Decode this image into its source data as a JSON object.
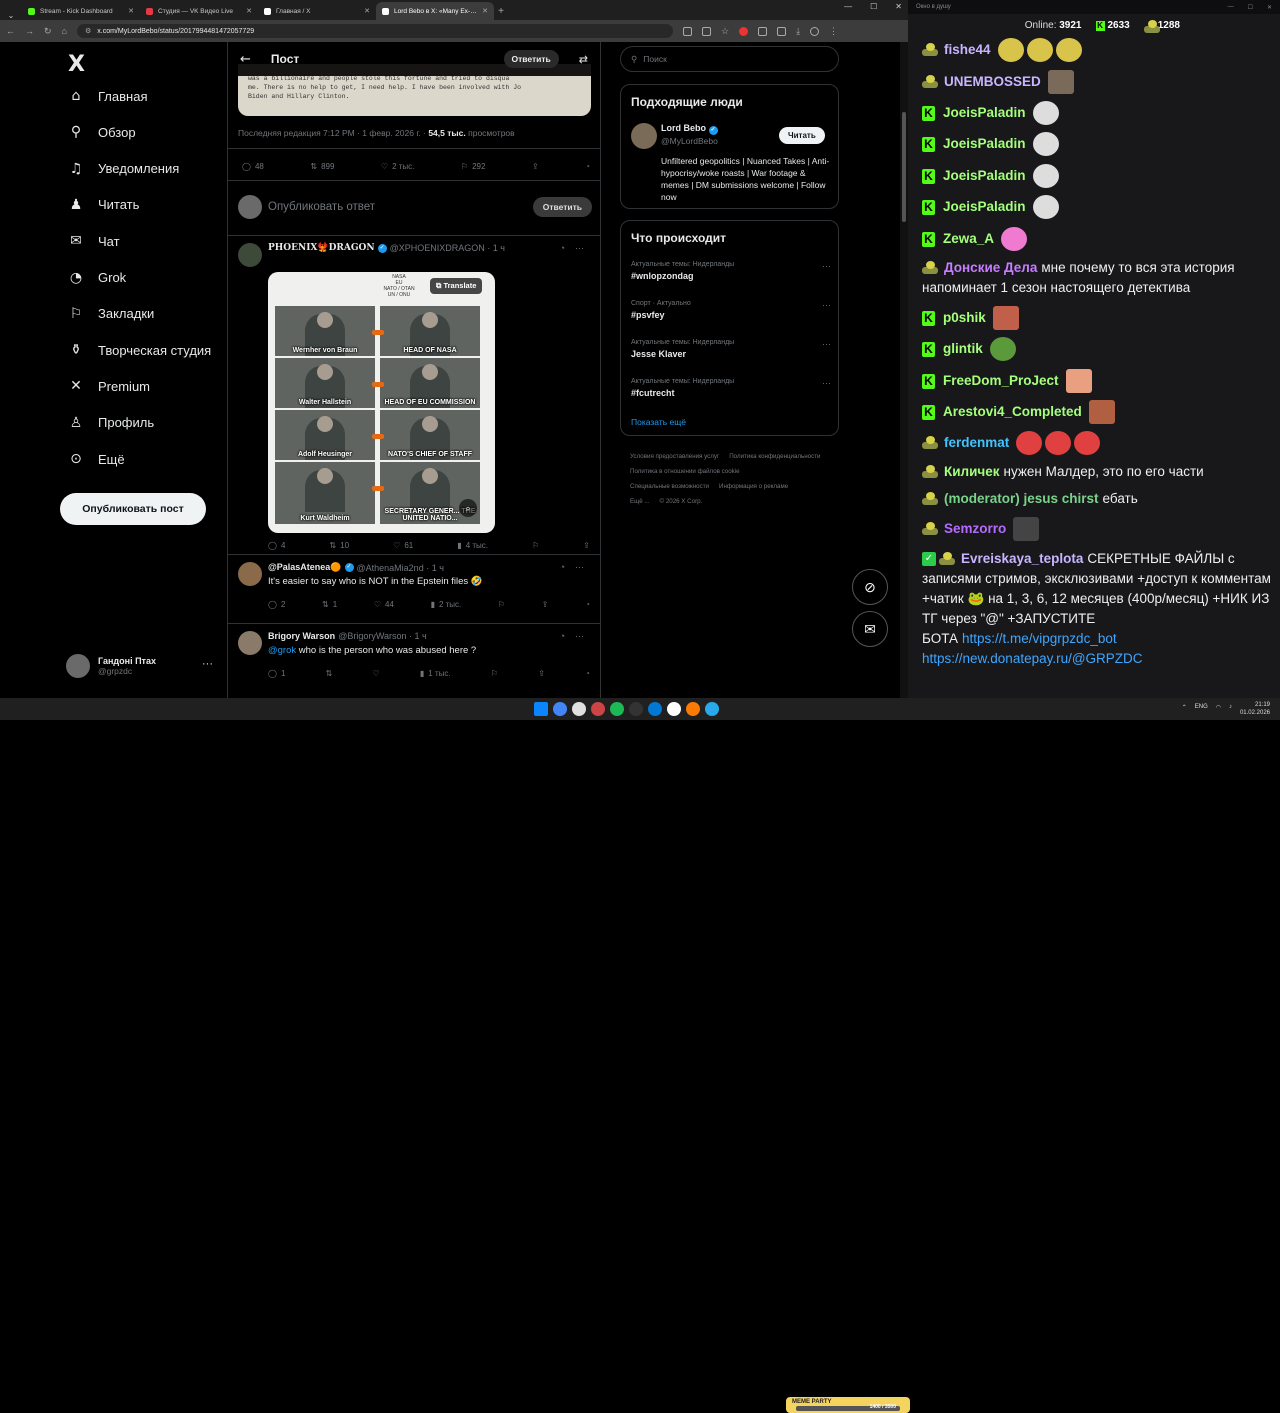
{
  "browser": {
    "tabs": [
      {
        "title": "Stream - Kick Dashboard",
        "color": "#53fc18"
      },
      {
        "title": "Студия — VK Видео Live",
        "color": "#e63946"
      },
      {
        "title": "Главная / X",
        "color": "#ffffff"
      },
      {
        "title": "Lord Bebo в X: «Many Ex-NAS",
        "color": "#ffffff",
        "active": true
      }
    ],
    "url": "x.com/MyLordBebo/status/2017994481472057729",
    "window_controls": [
      "—",
      "☐",
      "✕"
    ]
  },
  "x": {
    "logo": "X",
    "nav": [
      {
        "label": "Главная",
        "icon": "home-icon",
        "glyph": "⌂"
      },
      {
        "label": "Обзор",
        "icon": "search-icon",
        "glyph": "⚲"
      },
      {
        "label": "Уведомления",
        "icon": "bell-icon",
        "glyph": "♫"
      },
      {
        "label": "Читать",
        "icon": "follow-icon",
        "glyph": "♟"
      },
      {
        "label": "Чат",
        "icon": "mail-icon",
        "glyph": "✉"
      },
      {
        "label": "Grok",
        "icon": "grok-icon",
        "glyph": "◔"
      },
      {
        "label": "Закладки",
        "icon": "bookmark-icon",
        "glyph": "⚐"
      },
      {
        "label": "Творческая студия",
        "icon": "studio-icon",
        "glyph": "⚱"
      },
      {
        "label": "Premium",
        "icon": "premium-icon",
        "glyph": "✕"
      },
      {
        "label": "Профиль",
        "icon": "profile-icon",
        "glyph": "♙"
      },
      {
        "label": "Ещё",
        "icon": "more-icon",
        "glyph": "⊙"
      }
    ],
    "post_button": "Опубликовать пост",
    "account": {
      "name": "Гандоні Птах",
      "handle": "@grpzdc"
    },
    "header": {
      "title": "Пост",
      "reply": "Ответить"
    },
    "doc_text": "was a billionaire and people stole this fortune and tried to disqua\nme. There is no help to get, I need help. I have been involved with Jo\nBiden and Hillary Clinton.",
    "meta": {
      "edited": "Последняя редакция 7:12 PM · 1 февр. 2026 г. ·",
      "views": "54,5 тыс.",
      "views_label": "просмотров"
    },
    "main_actions": {
      "replies": "48",
      "reposts": "899",
      "likes": "2 тыс.",
      "views": "292"
    },
    "compose": {
      "placeholder": "Опубликовать ответ",
      "button": "Ответить"
    },
    "tweets": [
      {
        "name": "PHOENIX🐦‍🔥DRAGON",
        "handle": "@XPHOENIXDRAGON · 1 ч",
        "translate": "Translate",
        "image_header": [
          "NASA",
          "EU",
          "NATO / OTAN",
          "UN / ONU"
        ],
        "image_labels": [
          "Wernher von Braun",
          "HEAD OF NASA",
          "Walter Hallstein",
          "HEAD OF EU COMMISSION",
          "Adolf Heusinger",
          "NATO'S CHIEF OF STAFF",
          "Kurt Waldheim",
          "SECRETARY GENER... THE UNITED NATIO..."
        ],
        "actions": {
          "replies": "4",
          "reposts": "10",
          "likes": "61",
          "views": "4 тыс."
        }
      },
      {
        "name": "@PalasAtenea🟠",
        "handle": "@AthenaMia2nd · 1 ч",
        "text": "It's easier to say who is NOT in the Epstein files 🤣",
        "actions": {
          "replies": "2",
          "reposts": "1",
          "likes": "44",
          "views": "2 тыс."
        }
      },
      {
        "name": "Brigory Warson",
        "handle": "@BrigoryWarson · 1 ч",
        "mention": "@grok",
        "text": " who is the person who was abused here ?",
        "actions": {
          "replies": "1",
          "reposts": "",
          "likes": "",
          "views": "1 тыс."
        }
      }
    ],
    "search_placeholder": "Поиск",
    "people": {
      "title": "Подходящие люди",
      "name": "Lord Bebo",
      "handle": "@MyLordBebo",
      "follow": "Читать",
      "bio": "Unfiltered geopolitics | Nuanced Takes | Anti- hypocrisy/woke roasts | War footage & memes | DM submissions welcome | Follow now"
    },
    "trends": {
      "title": "Что происходит",
      "items": [
        {
          "cat": "Актуальные темы: Нидерланды",
          "tag": "#wnlopzondag"
        },
        {
          "cat": "Спорт · Актуально",
          "tag": "#psvfey"
        },
        {
          "cat": "Актуальные темы: Нидерланды",
          "tag": "Jesse Klaver"
        },
        {
          "cat": "Актуальные темы: Нидерланды",
          "tag": "#fcutrecht"
        }
      ],
      "show_more": "Показать ещё"
    },
    "footer": [
      "Условия предоставления услуг",
      "Политика конфиденциальности",
      "Политика в отношении файлов cookie",
      "Специальные возможности",
      "Информация о рекламе",
      "Ещё ...",
      "© 2026 X Corp."
    ]
  },
  "chat": {
    "window_title": "Окно в душу",
    "online_label": "Online:",
    "online": "3921",
    "kick_count": "2633",
    "gold_count": "1288",
    "messages": [
      {
        "badge": "g",
        "user": "fishe44",
        "color": "#c8b5ff",
        "text": "",
        "emotes": [
          "#d8c44a",
          "#d8c44a",
          "#d8c44a"
        ]
      },
      {
        "badge": "g",
        "user": "UNEMBOSSED",
        "color": "#c8b5ff",
        "text": "",
        "emotes": [
          "#7a6a5a"
        ]
      },
      {
        "badge": "k",
        "user": "JoeisPaladin",
        "color": "#a4ff7a",
        "text": "",
        "emotes": [
          "#dddddd"
        ]
      },
      {
        "badge": "k",
        "user": "JoeisPaladin",
        "color": "#a4ff7a",
        "text": "",
        "emotes": [
          "#dddddd"
        ]
      },
      {
        "badge": "k",
        "user": "JoeisPaladin",
        "color": "#a4ff7a",
        "text": "",
        "emotes": [
          "#dddddd"
        ]
      },
      {
        "badge": "k",
        "user": "JoeisPaladin",
        "color": "#a4ff7a",
        "text": "",
        "emotes": [
          "#dddddd"
        ]
      },
      {
        "badge": "k",
        "user": "Zewa_A",
        "color": "#a4ff7a",
        "text": "",
        "emotes": [
          "#f07ad0"
        ]
      },
      {
        "badge": "g",
        "user": "Донские Дела",
        "color": "#c77dff",
        "text": "мне почему то вся эта история напоминает 1 сезон настоящего детектива",
        "emotes": []
      },
      {
        "badge": "k",
        "user": "p0shik",
        "color": "#a4ff7a",
        "text": "",
        "emotes": [
          "#c0604a"
        ]
      },
      {
        "badge": "k",
        "user": "glintik",
        "color": "#a4ff7a",
        "text": "",
        "emotes": [
          "#5a9a3a"
        ]
      },
      {
        "badge": "k",
        "user": "FreeDom_ProJect",
        "color": "#a4ff7a",
        "text": "",
        "emotes": [
          "#e8a080"
        ]
      },
      {
        "badge": "k",
        "user": "Arestovi4_Completed",
        "color": "#a4ff7a",
        "text": "",
        "emotes": [
          "#b06040"
        ]
      },
      {
        "badge": "g",
        "user": "ferdenmat",
        "color": "#3ec5ff",
        "text": "",
        "emotes": [
          "#e04040",
          "#e04040",
          "#e04040"
        ]
      },
      {
        "badge": "g",
        "user": "Киличек",
        "color": "#a4ff7a",
        "text": "нужен Малдер, это по его части",
        "emotes": []
      },
      {
        "badge": "g",
        "user": "(moderator) jesus chirst",
        "color": "#7ad38a",
        "text": "ебать",
        "emotes": []
      },
      {
        "badge": "g",
        "user": "Semzorro",
        "color": "#b56bff",
        "text": "",
        "emotes": [
          "#444444"
        ]
      },
      {
        "badge": "cg",
        "user": "Evreiskaya_teplota",
        "color": "#c8b5ff",
        "text": "СЕКРЕТНЫЕ ФАЙЛЫ с записями стримов, эксклюзивами +доступ к комментам +чатик 🐸 на 1, 3, 6, 12 месяцев (400р/месяц) +НИК ИЗ ТГ через \"@\" +ЗАПУСТИТЕ БОТА",
        "link1": "https://t.me/vipgrpzdc_bot",
        "link2": "https://new.donatepay.ru/@GRPZDC",
        "emotes": []
      }
    ]
  },
  "taskbar": {
    "overlay_title": "MEME PARTY",
    "overlay_value": "1400 / 3500",
    "lang": "ENG",
    "time": "21:19",
    "date": "01.02.2026"
  }
}
